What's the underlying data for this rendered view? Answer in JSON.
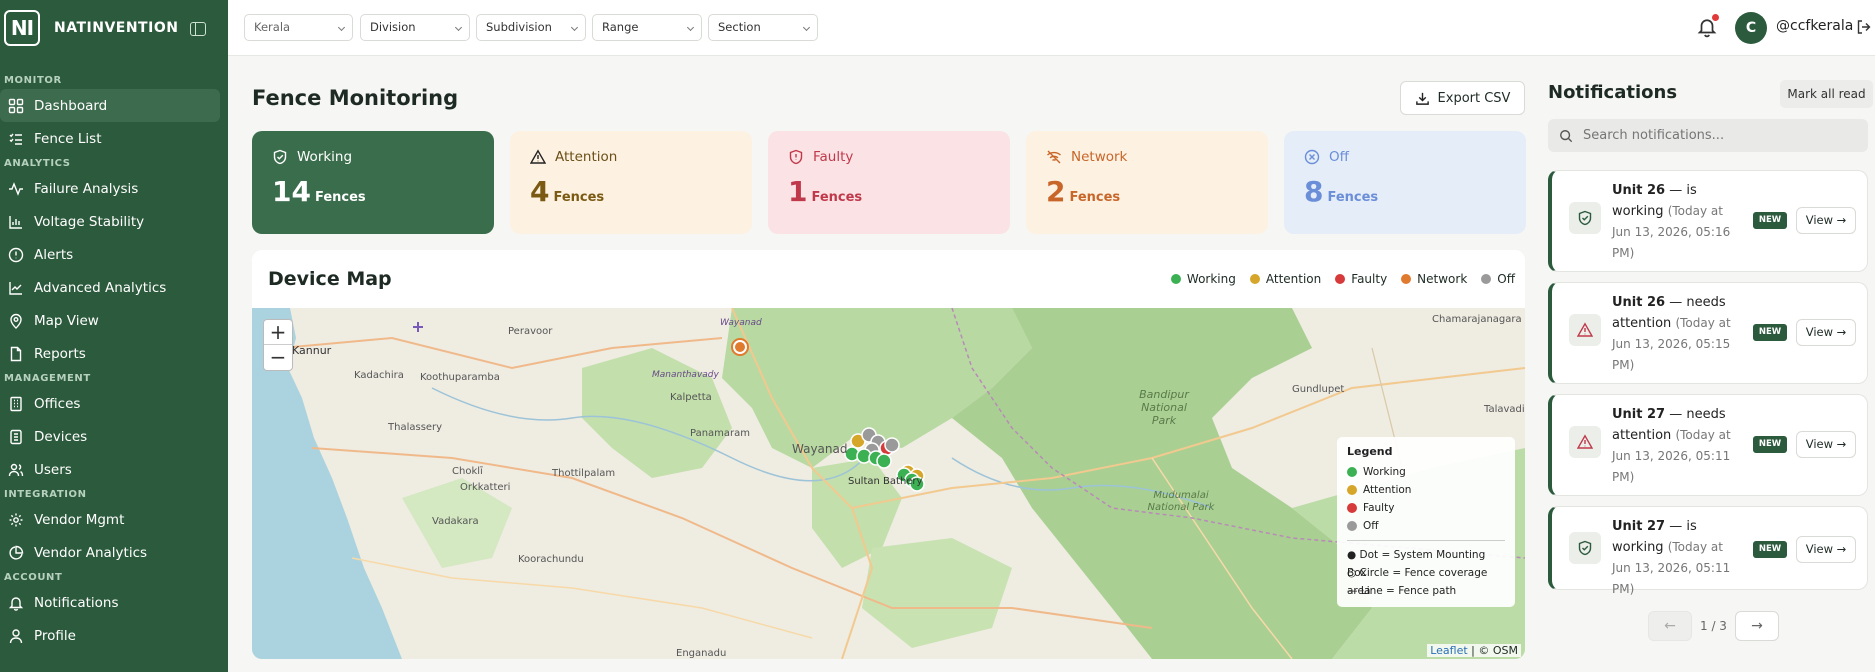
{
  "brand": {
    "logo": "NI",
    "name": "NATINVENTION"
  },
  "sidebar": {
    "sections": {
      "monitor": "MONITOR",
      "analytics": "ANALYTICS",
      "management": "MANAGEMENT",
      "integration": "INTEGRATION",
      "account": "ACCOUNT"
    },
    "items": [
      {
        "label": "Dashboard",
        "icon": "dashboard-icon",
        "active": true
      },
      {
        "label": "Fence List",
        "icon": "list-icon"
      },
      {
        "label": "Failure Analysis",
        "icon": "activity-icon"
      },
      {
        "label": "Voltage Stability",
        "icon": "bar-chart-icon"
      },
      {
        "label": "Alerts",
        "icon": "alert-circle-icon"
      },
      {
        "label": "Advanced Analytics",
        "icon": "line-chart-icon"
      },
      {
        "label": "Map View",
        "icon": "map-pin-icon"
      },
      {
        "label": "Reports",
        "icon": "file-icon"
      },
      {
        "label": "Offices",
        "icon": "building-icon"
      },
      {
        "label": "Devices",
        "icon": "device-icon"
      },
      {
        "label": "Users",
        "icon": "users-icon"
      },
      {
        "label": "Vendor Mgmt",
        "icon": "settings-icon"
      },
      {
        "label": "Vendor Analytics",
        "icon": "pie-chart-icon"
      },
      {
        "label": "Notifications",
        "icon": "bell-icon"
      },
      {
        "label": "Profile",
        "icon": "user-icon"
      }
    ]
  },
  "filters": {
    "state": "Kerala",
    "division": "Division",
    "subdivision": "Subdivision",
    "range": "Range",
    "section": "Section"
  },
  "user": {
    "initial": "C",
    "name": "@ccfkerala"
  },
  "page": {
    "title": "Fence Monitoring",
    "export_label": "Export CSV"
  },
  "stats": [
    {
      "label": "Working",
      "count": "14",
      "unit": "Fences",
      "icon": "shield-check-icon",
      "color": "#2c5a3d"
    },
    {
      "label": "Attention",
      "count": "4",
      "unit": "Fences",
      "icon": "warning-triangle-icon",
      "color": "#7a5a12"
    },
    {
      "label": "Faulty",
      "count": "1",
      "unit": "Fences",
      "icon": "shield-alert-icon",
      "color": "#c0394b"
    },
    {
      "label": "Network",
      "count": "2",
      "unit": "Fences",
      "icon": "wifi-off-icon",
      "color": "#c8662a"
    },
    {
      "label": "Off",
      "count": "8",
      "unit": "Fences",
      "icon": "x-circle-icon",
      "color": "#6a8ed8"
    }
  ],
  "map": {
    "title": "Device Map",
    "legend_top": [
      {
        "label": "Working",
        "color": "#3cb153"
      },
      {
        "label": "Attention",
        "color": "#d6a62a"
      },
      {
        "label": "Faulty",
        "color": "#d63a3a"
      },
      {
        "label": "Network",
        "color": "#e07a2e"
      },
      {
        "label": "Off",
        "color": "#9a9a9a"
      }
    ],
    "place_labels": [
      "Kannur",
      "Peravoor",
      "Wayanad",
      "Kadachira",
      "Koothuparamba",
      "Mananthavady",
      "Thalassery",
      "Panamaram",
      "Wayanad",
      "Choklī",
      "Orkkatteri",
      "Thottilpalam",
      "Sultan Bathery",
      "Vadakara",
      "Kalpetta",
      "Koorachundu",
      "Bandipur National Park",
      "Mudumalai National Park",
      "Gundlupet",
      "Chamarajanagara",
      "Talavadi",
      "Enganadu"
    ],
    "legend_box": {
      "title": "Legend",
      "items": [
        {
          "label": "Working",
          "color": "#3cb153"
        },
        {
          "label": "Attention",
          "color": "#d6a62a"
        },
        {
          "label": "Faulty",
          "color": "#d63a3a"
        },
        {
          "label": "Off",
          "color": "#9a9a9a"
        }
      ],
      "notes": [
        "● Dot = System Mounting Box",
        "○ Circle = Fence coverage area",
        "— Line = Fence path"
      ]
    },
    "zoom_in": "+",
    "zoom_out": "−",
    "attribution_leaflet": "Leaflet",
    "attribution_osm": "| © OSM"
  },
  "notifications": {
    "title": "Notifications",
    "mark_all": "Mark all read",
    "search_placeholder": "Search notifications...",
    "items": [
      {
        "unit": "Unit 26",
        "msg": " — is working ",
        "time": "(Today at Jun 13, 2026, 05:16 PM)",
        "badge": "NEW",
        "view": "View →",
        "icon": "shield-check-icon"
      },
      {
        "unit": "Unit 26",
        "msg": " — needs attention ",
        "time": "(Today at Jun 13, 2026, 05:15 PM)",
        "badge": "NEW",
        "view": "View →",
        "icon": "warning-triangle-icon"
      },
      {
        "unit": "Unit 27",
        "msg": " — needs attention ",
        "time": "(Today at Jun 13, 2026, 05:11 PM)",
        "badge": "NEW",
        "view": "View →",
        "icon": "warning-triangle-icon"
      },
      {
        "unit": "Unit 27",
        "msg": " — is working ",
        "time": "(Today at Jun 13, 2026, 05:11 PM)",
        "badge": "NEW",
        "view": "View →",
        "icon": "shield-check-icon"
      }
    ],
    "pager": {
      "prev": "←",
      "page": "1 / 3",
      "next": "→"
    }
  }
}
